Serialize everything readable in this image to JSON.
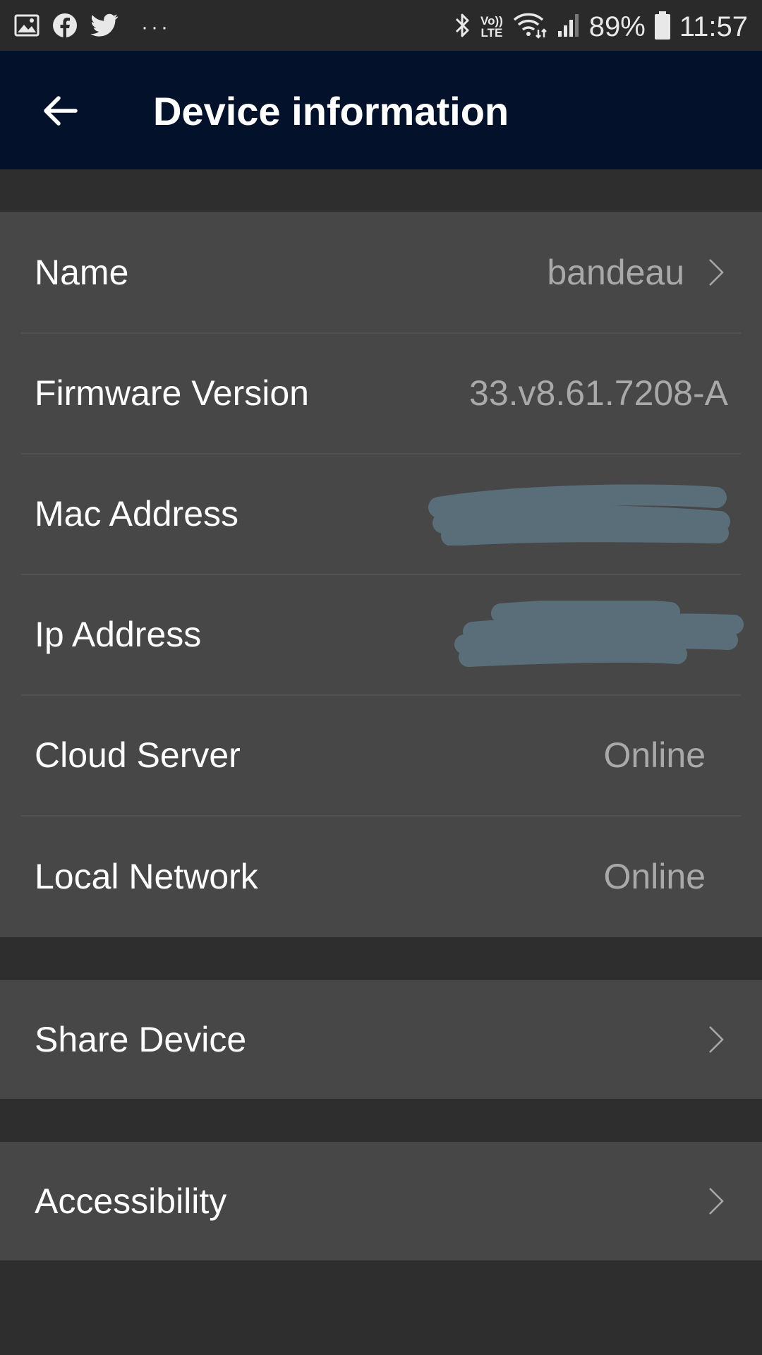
{
  "status_bar": {
    "icons_left": [
      "gallery-icon",
      "facebook-icon",
      "twitter-icon",
      "more-dots-icon"
    ],
    "more_dots": "···",
    "volte_top": "Vo))",
    "volte_bottom": "LTE",
    "battery_percent": "89%",
    "time": "11:57"
  },
  "app_bar": {
    "title": "Device information",
    "back_icon": "arrow-left-icon",
    "background": "#03112a"
  },
  "device_info": {
    "rows": [
      {
        "label": "Name",
        "value": "bandeau",
        "has_chevron": true
      },
      {
        "label": "Firmware Version",
        "value": "33.v8.61.7208-A",
        "has_chevron": false
      },
      {
        "label": "Mac Address",
        "value": "",
        "redacted": true
      },
      {
        "label": "Ip Address",
        "value": "",
        "redacted": true
      },
      {
        "label": "Cloud Server",
        "value": "Online"
      },
      {
        "label": "Local Network",
        "value": "Online"
      }
    ]
  },
  "share_device": {
    "label": "Share Device",
    "icon": "chevron-right-icon"
  },
  "accessibility": {
    "label": "Accessibility",
    "icon": "chevron-right-icon"
  },
  "colors": {
    "page_background": "#2e2e2e",
    "card_background": "#474747",
    "value_text": "#a9a9a9",
    "redaction": "#5a6e79"
  }
}
